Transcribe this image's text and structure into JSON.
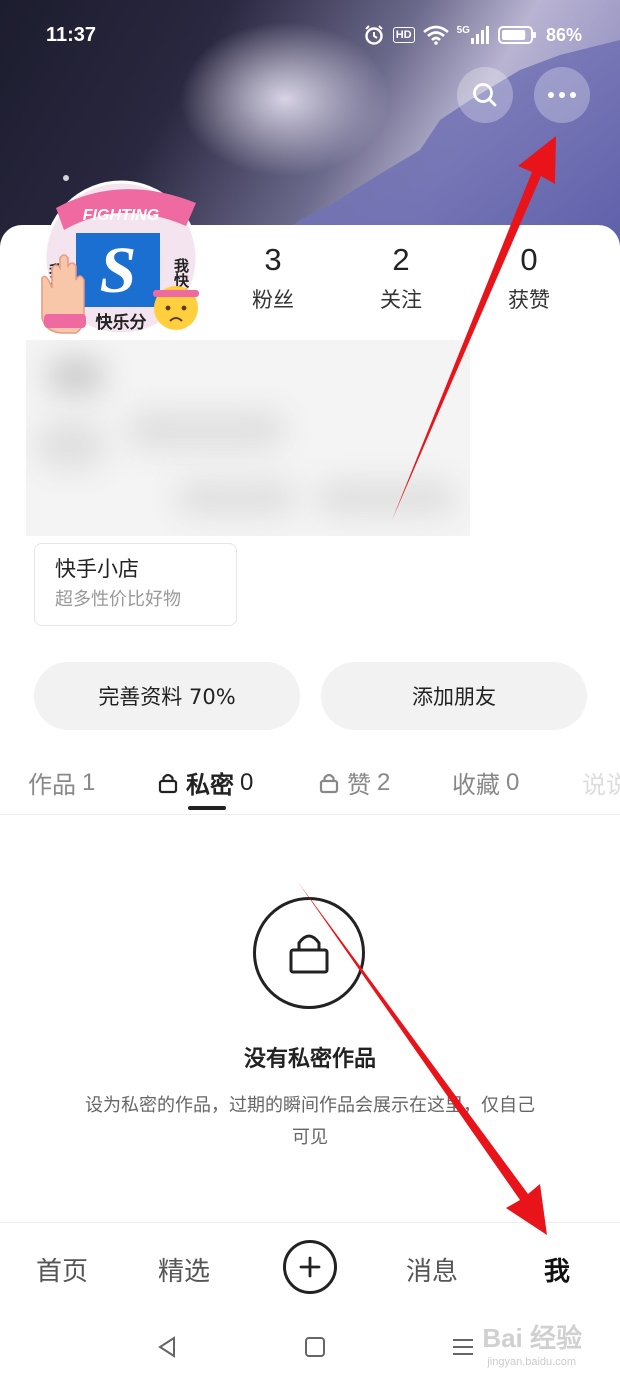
{
  "status_bar": {
    "time": "11:37",
    "hd": "HD",
    "signal": "5G",
    "battery": "86%",
    "battery_level": 0.86
  },
  "header": {
    "search_icon": "search-icon",
    "more_icon": "more-dots-icon"
  },
  "avatar": {
    "banner_text": "FIGHTING",
    "left_text": "我分享",
    "right_text": "我快乐",
    "bottom_text": "快乐分",
    "logo_letter": "S"
  },
  "stats": [
    {
      "num": "3",
      "label": "粉丝"
    },
    {
      "num": "2",
      "label": "关注"
    },
    {
      "num": "0",
      "label": "获赞"
    }
  ],
  "shop": {
    "title": "快手小店",
    "subtitle": "超多性价比好物"
  },
  "actions": {
    "complete_profile": "完善资料 70%",
    "add_friend": "添加朋友"
  },
  "tabs": [
    {
      "label": "作品",
      "count": "1"
    },
    {
      "label": "私密",
      "count": "0"
    },
    {
      "label": "赞",
      "count": "2"
    },
    {
      "label": "收藏",
      "count": "0"
    },
    {
      "label": "说说",
      "count": ""
    }
  ],
  "empty_state": {
    "title": "没有私密作品",
    "description": "设为私密的作品，过期的瞬间作品会展示在这里，仅自己可见"
  },
  "bottom_nav": {
    "home": "首页",
    "featured": "精选",
    "messages": "消息",
    "me": "我"
  },
  "watermark": {
    "text": "Bai 经验",
    "sub": "jingyan.baidu.com"
  },
  "colors": {
    "accent_arrow": "#e8141a",
    "text_primary": "#222222",
    "text_secondary": "#999999"
  }
}
